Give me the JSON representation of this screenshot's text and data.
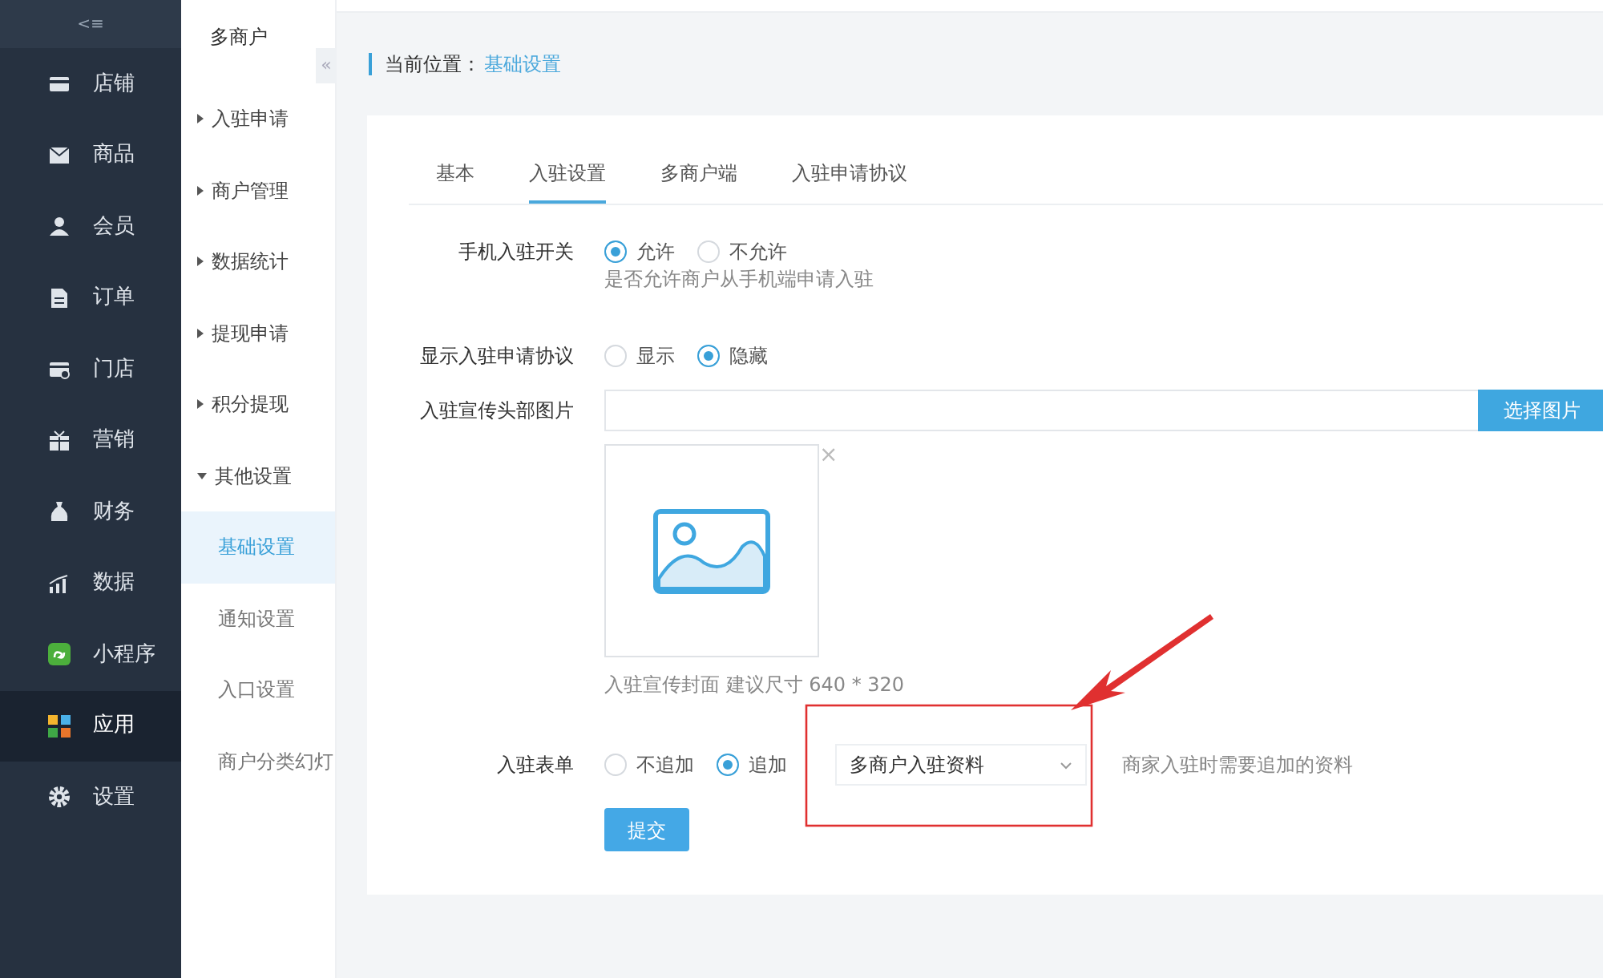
{
  "nav": {
    "toggle": "<≡",
    "items": [
      {
        "label": "店铺",
        "selected": false
      },
      {
        "label": "商品",
        "selected": false
      },
      {
        "label": "会员",
        "selected": false
      },
      {
        "label": "订单",
        "selected": false
      },
      {
        "label": "门店",
        "selected": false
      },
      {
        "label": "营销",
        "selected": false
      },
      {
        "label": "财务",
        "selected": false
      },
      {
        "label": "数据",
        "selected": false
      },
      {
        "label": "小程序",
        "selected": false
      },
      {
        "label": "应用",
        "selected": true
      },
      {
        "label": "设置",
        "selected": false
      }
    ]
  },
  "subnav": {
    "title": "多商户",
    "collapse": "«",
    "items": [
      {
        "label": "入驻申请",
        "kind": "group",
        "expanded": false
      },
      {
        "label": "商户管理",
        "kind": "group",
        "expanded": false
      },
      {
        "label": "数据统计",
        "kind": "group",
        "expanded": false
      },
      {
        "label": "提现申请",
        "kind": "group",
        "expanded": false
      },
      {
        "label": "积分提现",
        "kind": "group",
        "expanded": false
      },
      {
        "label": "其他设置",
        "kind": "group",
        "expanded": true
      },
      {
        "label": "基础设置",
        "kind": "link",
        "selected": true
      },
      {
        "label": "通知设置",
        "kind": "link",
        "selected": false
      },
      {
        "label": "入口设置",
        "kind": "link",
        "selected": false
      },
      {
        "label": "商户分类幻灯",
        "kind": "link",
        "selected": false
      }
    ]
  },
  "breadcrumb": {
    "label": "当前位置：",
    "current": "基础设置"
  },
  "tabs": [
    {
      "label": "基本",
      "selected": false
    },
    {
      "label": "入驻设置",
      "selected": true
    },
    {
      "label": "多商户端",
      "selected": false
    },
    {
      "label": "入驻申请协议",
      "selected": false
    }
  ],
  "form": [
    {
      "kind": "radio",
      "label": "手机入驻开关",
      "options": [
        {
          "label": "允许",
          "selected": true
        },
        {
          "label": "不允许",
          "selected": false
        }
      ],
      "help": "是否允许商户从手机端申请入驻"
    },
    {
      "kind": "radio",
      "label": "显示入驻申请协议",
      "options": [
        {
          "label": "显示",
          "selected": false
        },
        {
          "label": "隐藏",
          "selected": true
        }
      ]
    },
    {
      "kind": "upload",
      "label": "入驻宣传头部图片",
      "button": "选择图片",
      "remove": "×",
      "help": "入驻宣传封面 建议尺寸 640 * 320"
    },
    {
      "kind": "radio-select",
      "label": "入驻表单",
      "options": [
        {
          "label": "不追加",
          "selected": false
        },
        {
          "label": "追加",
          "selected": true
        }
      ],
      "select": "多商户入驻资料",
      "help": "商家入驻时需要追加的资料"
    }
  ],
  "submit": "提交",
  "annotation": {
    "color": "#e03030"
  }
}
